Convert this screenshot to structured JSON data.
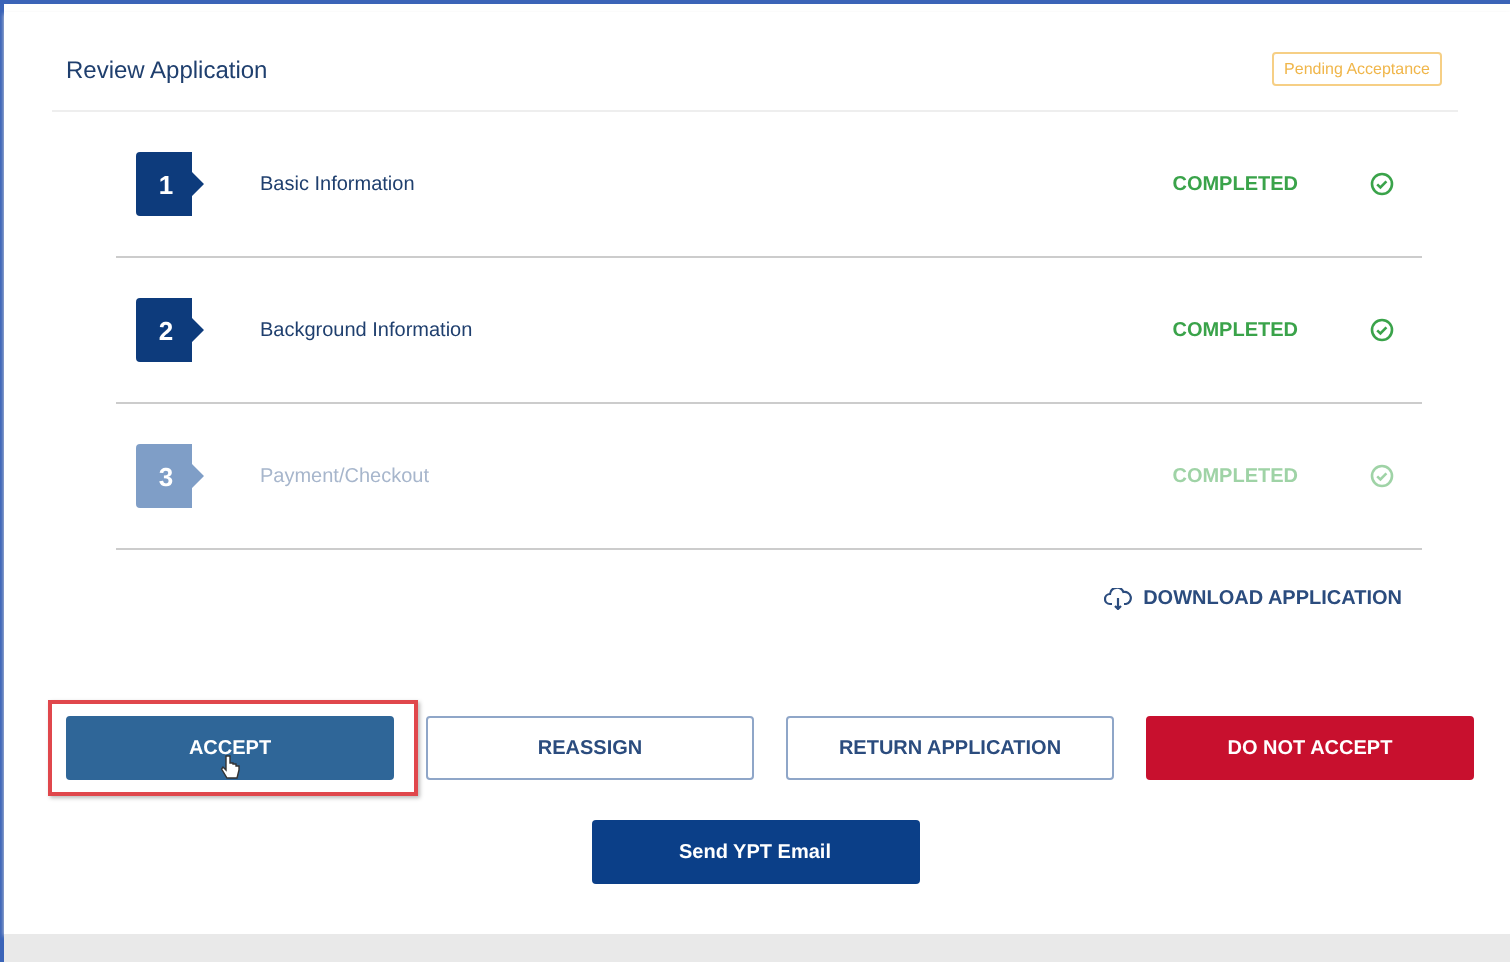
{
  "card": {
    "title": "Review Application",
    "status_badge": "Pending Acceptance"
  },
  "steps": [
    {
      "number": "1",
      "label": "Basic Information",
      "status": "COMPLETED",
      "disabled": false
    },
    {
      "number": "2",
      "label": "Background Information",
      "status": "COMPLETED",
      "disabled": false
    },
    {
      "number": "3",
      "label": "Payment/Checkout",
      "status": "COMPLETED",
      "disabled": true
    }
  ],
  "download_link": "DOWNLOAD APPLICATION",
  "actions": [
    {
      "label": "ACCEPT",
      "kind": "primary",
      "highlighted": true
    },
    {
      "label": "REASSIGN",
      "kind": "outline",
      "highlighted": false
    },
    {
      "label": "RETURN APPLICATION",
      "kind": "outline",
      "highlighted": false
    },
    {
      "label": "DO NOT ACCEPT",
      "kind": "danger",
      "highlighted": false
    }
  ],
  "secondary_action": {
    "label": "Send YPT Email"
  }
}
